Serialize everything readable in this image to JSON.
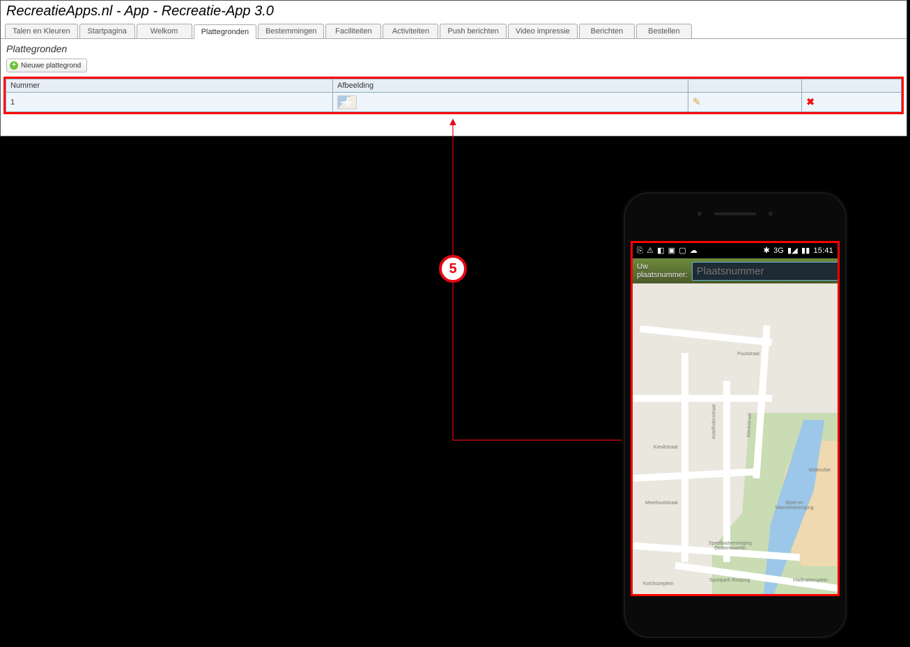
{
  "page": {
    "title": "RecreatieApps.nl - App - Recreatie-App 3.0",
    "section_title": "Plattegronden"
  },
  "tabs": [
    "Talen en Kleuren",
    "Startpagina",
    "Welkom",
    "Plattegronden",
    "Bestemmingen",
    "Faciliteiten",
    "Activiteiten",
    "Push berichten",
    "Video impressie",
    "Berichten",
    "Bestellen"
  ],
  "tabs_active_index": 3,
  "toolbar": {
    "new_label": "Nieuwe plattegrond"
  },
  "table": {
    "headers": {
      "nummer": "Nummer",
      "afbeelding": "Afbeelding"
    },
    "rows": [
      {
        "nummer": "1"
      }
    ]
  },
  "callout": {
    "number": "5"
  },
  "phone": {
    "status": {
      "left_icons": [
        "⎘",
        "⚠",
        "◧",
        "▣",
        "▢",
        "☁"
      ],
      "right_icons": [
        "✱",
        "3G",
        "▮◢",
        "▮▮"
      ],
      "time": "15:41",
      "net_label": "3G"
    },
    "search": {
      "label": "Uw plaatsnummer:",
      "placeholder": "Plaatsnummer"
    },
    "map_labels": {
      "puutstraat": "Puutstraat",
      "kievitstraat": "Kievitstraat",
      "astelholenstraat": "Astelholenstraat",
      "klenkstraat": "Klenkstraat",
      "meerkootstraat": "Meerkootstraat",
      "molenvliet": "Molenvliet",
      "stoel": "Stoel en Wasselvereniging",
      "speelbad": "Speelbadvereniging Oosterkwartier",
      "kolchozplein": "Kolchozeplein",
      "sportpark": "Sportpark Roojong",
      "hadinah": "Hadinaheisplein"
    }
  }
}
